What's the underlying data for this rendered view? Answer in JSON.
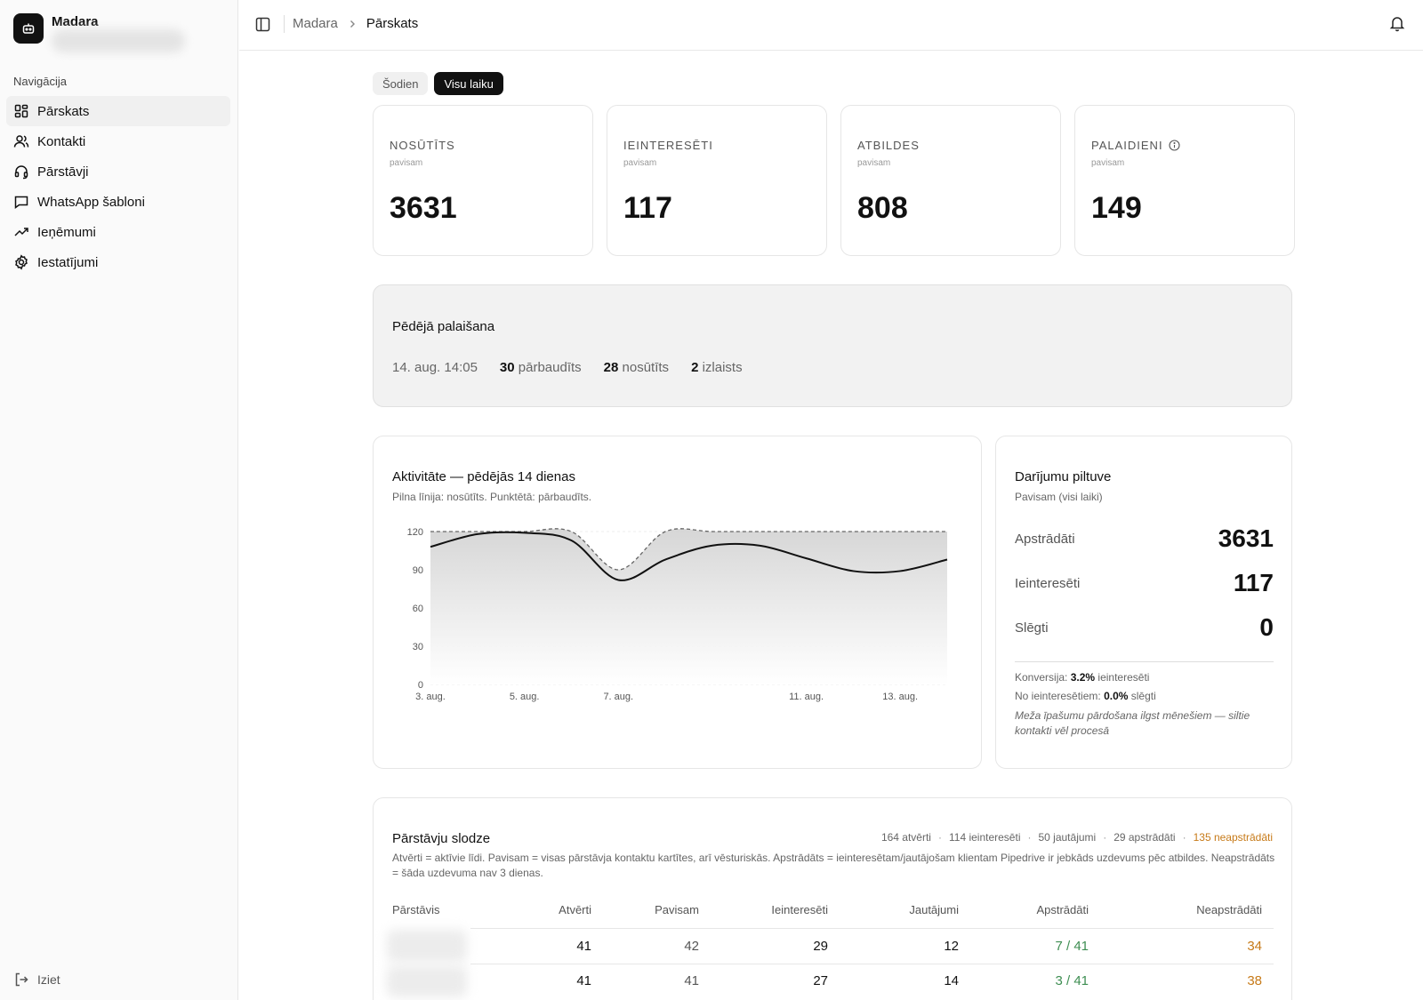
{
  "sidebar": {
    "brand_name": "Madara",
    "nav_heading": "Navigācija",
    "items": [
      {
        "label": "Pārskats",
        "icon": "dashboard-icon",
        "active": true
      },
      {
        "label": "Kontakti",
        "icon": "users-icon"
      },
      {
        "label": "Pārstāvji",
        "icon": "headset-icon"
      },
      {
        "label": "WhatsApp šabloni",
        "icon": "message-icon"
      },
      {
        "label": "Ieņēmumi",
        "icon": "trending-up-icon"
      },
      {
        "label": "Iestatījumi",
        "icon": "gear-icon"
      }
    ],
    "logout_label": "Iziet"
  },
  "header": {
    "breadcrumb_root": "Madara",
    "breadcrumb_current": "Pārskats"
  },
  "range": {
    "today": "Šodien",
    "all_time": "Visu laiku",
    "selected": "Visu laiku"
  },
  "stats": [
    {
      "label": "NOSŪTĪTS",
      "sub": "pavisam",
      "value": "3631"
    },
    {
      "label": "IEINTERESĒTI",
      "sub": "pavisam",
      "value": "117"
    },
    {
      "label": "ATBILDES",
      "sub": "pavisam",
      "value": "808"
    },
    {
      "label": "PALAIDIENI",
      "sub": "pavisam",
      "value": "149",
      "info_icon": "info-icon"
    }
  ],
  "last_run": {
    "title": "Pēdējā palaišana",
    "date": "14. aug. 14:05",
    "checked_num": "30",
    "checked_label": "pārbaudīts",
    "sent_num": "28",
    "sent_label": "nosūtīts",
    "skipped_num": "2",
    "skipped_label": "izlaists"
  },
  "activity": {
    "title": "Aktivitāte — pēdējās 14 dienas",
    "subtitle": "Pilna līnija: nosūtīts. Punktētā: pārbaudīts."
  },
  "chart_data": {
    "type": "area",
    "x": [
      "3. aug.",
      "4. aug.",
      "5. aug.",
      "6. aug.",
      "7. aug.",
      "8. aug.",
      "9. aug.",
      "10. aug.",
      "11. aug.",
      "12. aug.",
      "13. aug.",
      "14. aug."
    ],
    "tick_labels": [
      "3. aug.",
      "5. aug.",
      "7. aug.",
      "11. aug.",
      "13. aug."
    ],
    "series": [
      {
        "role": "sent",
        "style": "solid",
        "values": [
          108,
          118,
          119,
          113,
          82,
          98,
          109,
          109,
          99,
          89,
          89,
          98
        ]
      },
      {
        "role": "checked",
        "style": "dashed",
        "values": [
          120,
          120,
          120,
          120,
          90,
          120,
          120,
          120,
          120,
          120,
          120,
          120
        ]
      }
    ],
    "ylim": [
      0,
      120
    ],
    "yticks": [
      0,
      30,
      60,
      90,
      120
    ],
    "grid": true,
    "colors": {
      "line": "#111111",
      "fill": "#d9d9d9"
    }
  },
  "funnel": {
    "title": "Darījumu piltuve",
    "subtitle": "Pavisam (visi laiki)",
    "rows": [
      {
        "label": "Apstrādāti",
        "value": "3631"
      },
      {
        "label": "Ieinteresēti",
        "value": "117"
      },
      {
        "label": "Slēgti",
        "value": "0"
      }
    ],
    "conv_label": "Konversija:",
    "conv_value": "3.2%",
    "conv_suffix": "ieinteresēti",
    "closed_label": "No ieinteresētiem:",
    "closed_value": "0.0%",
    "closed_suffix": "slēgti",
    "note": "Meža īpašumu pārdošana ilgst mēnešiem — siltie kontakti vēl procesā"
  },
  "load": {
    "title": "Pārstāvju slodze",
    "stats": [
      "164 atvērti",
      "114 ieinteresēti",
      "50 jautājumi",
      "29 apstrādāti"
    ],
    "stats_warn": "135 neapstrādāti",
    "description": "Atvērti = aktīvie līdi. Pavisam = visas pārstāvja kontaktu kartītes, arī vēsturiskās. Apstrādāts = ieinteresētam/jautājošam klientam Pipedrive ir jebkāds uzdevums pēc atbildes. Neapstrādāts = šāda uzdevuma nav 3 dienas.",
    "columns": [
      "Pārstāvis",
      "Atvērti",
      "Pavisam",
      "Ieinteresēti",
      "Jautājumi",
      "Apstrādāti",
      "Neapstrādāti"
    ],
    "rows": [
      {
        "open": "41",
        "total": "42",
        "interested": "29",
        "questions": "12",
        "handled": "7 / 41",
        "unhandled": "34"
      },
      {
        "open": "41",
        "total": "41",
        "interested": "27",
        "questions": "14",
        "handled": "3 / 41",
        "unhandled": "38"
      }
    ]
  }
}
